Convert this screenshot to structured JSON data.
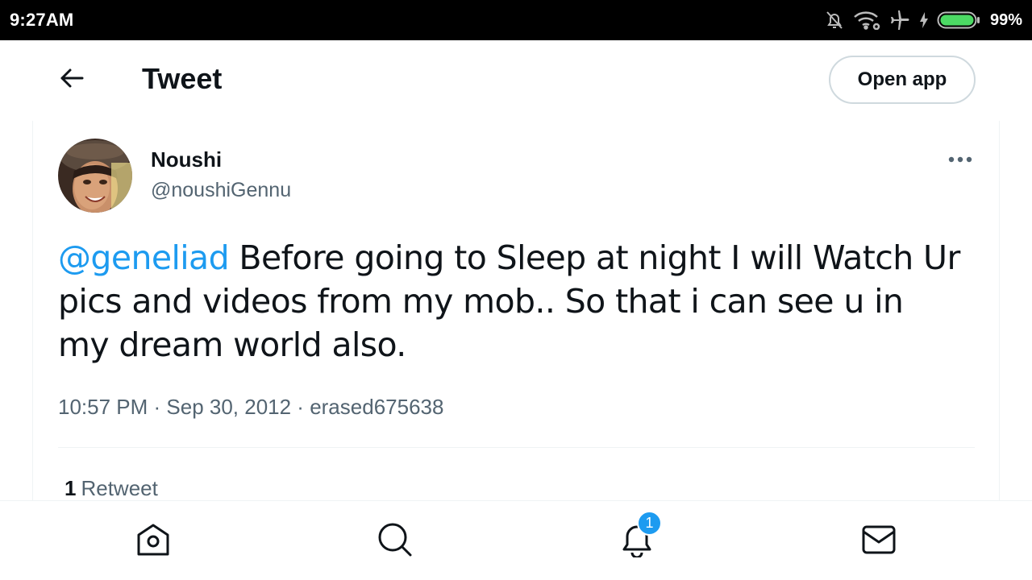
{
  "status_bar": {
    "time": "9:27AM",
    "battery_percent": "99%",
    "icons": [
      "bell-off-icon",
      "wifi-icon",
      "airplane-icon",
      "charging-icon",
      "battery-icon"
    ]
  },
  "header": {
    "title": "Tweet",
    "open_app_label": "Open app",
    "back_icon": "arrow-left-icon"
  },
  "tweet": {
    "display_name": "Noushi",
    "username": "@noushiGennu",
    "mention": "@geneliad",
    "text": " Before going to Sleep at night I will Watch Ur pics and videos from my mob.. So that i can see u in my dream world also.",
    "meta": "10:57 PM · Sep 30, 2012 · erased675638",
    "retweet_count": "1",
    "retweet_label": "Retweet"
  },
  "bottom_nav": {
    "items": [
      "home-icon",
      "search-icon",
      "notifications-icon",
      "messages-icon"
    ],
    "notification_badge": "1"
  },
  "colors": {
    "accent": "#1d9bf0",
    "text_primary": "#0f1419",
    "text_secondary": "#536471",
    "border": "#cfd9de",
    "battery": "#4cd964"
  }
}
